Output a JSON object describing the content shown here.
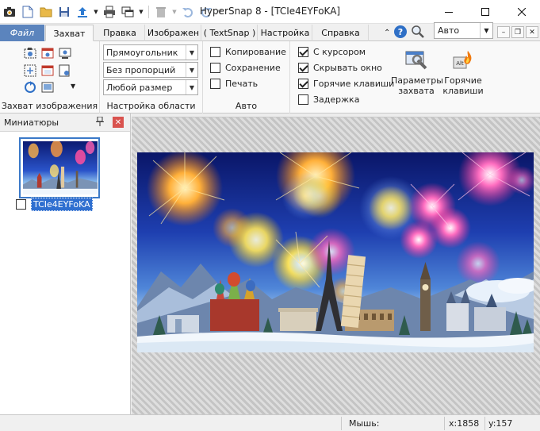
{
  "window": {
    "title": "HyperSnap 8 - [TCIe4EYFoKA]"
  },
  "tabs": [
    {
      "label": "Файл"
    },
    {
      "label": "Захват"
    },
    {
      "label": "Правка"
    },
    {
      "label": "Изображен"
    },
    {
      "label": "( TextSnap )"
    },
    {
      "label": "Настройка"
    },
    {
      "label": "Справка"
    }
  ],
  "zoom_combo": {
    "value": "Авто"
  },
  "ribbon": {
    "capture_group": {
      "label": "Захват изображения"
    },
    "region_group": {
      "label": "Настройка области",
      "shape": "Прямоугольник",
      "proportions": "Без пропорций",
      "size": "Любой размер"
    },
    "auto_group": {
      "label": "Авто",
      "copy": {
        "label": "Копирование",
        "checked": false
      },
      "save": {
        "label": "Сохранение",
        "checked": false
      },
      "print": {
        "label": "Печать",
        "checked": false
      }
    },
    "options_group": {
      "cursor": {
        "label": "С курсором",
        "checked": true
      },
      "hide": {
        "label": "Скрывать окно",
        "checked": true
      },
      "hotkeys": {
        "label": "Горячие клавиши",
        "checked": true
      },
      "delay": {
        "label": "Задержка",
        "checked": false
      }
    },
    "params_button": {
      "line1": "Параметры",
      "line2": "захвата"
    },
    "hotkeys_button": {
      "line1": "Горячие",
      "line2": "клавиши"
    }
  },
  "thumbnails": {
    "title": "Миниатюры",
    "items": [
      {
        "label": "TCIe4EYFoKA",
        "checked": false
      }
    ]
  },
  "status": {
    "mouse_label": "Мышь:",
    "x": "x:1858",
    "y": "y:157"
  },
  "colors": {
    "file_tab": "#5b84bd",
    "selection": "#2f6fd0",
    "panel_close": "#d9534f"
  }
}
